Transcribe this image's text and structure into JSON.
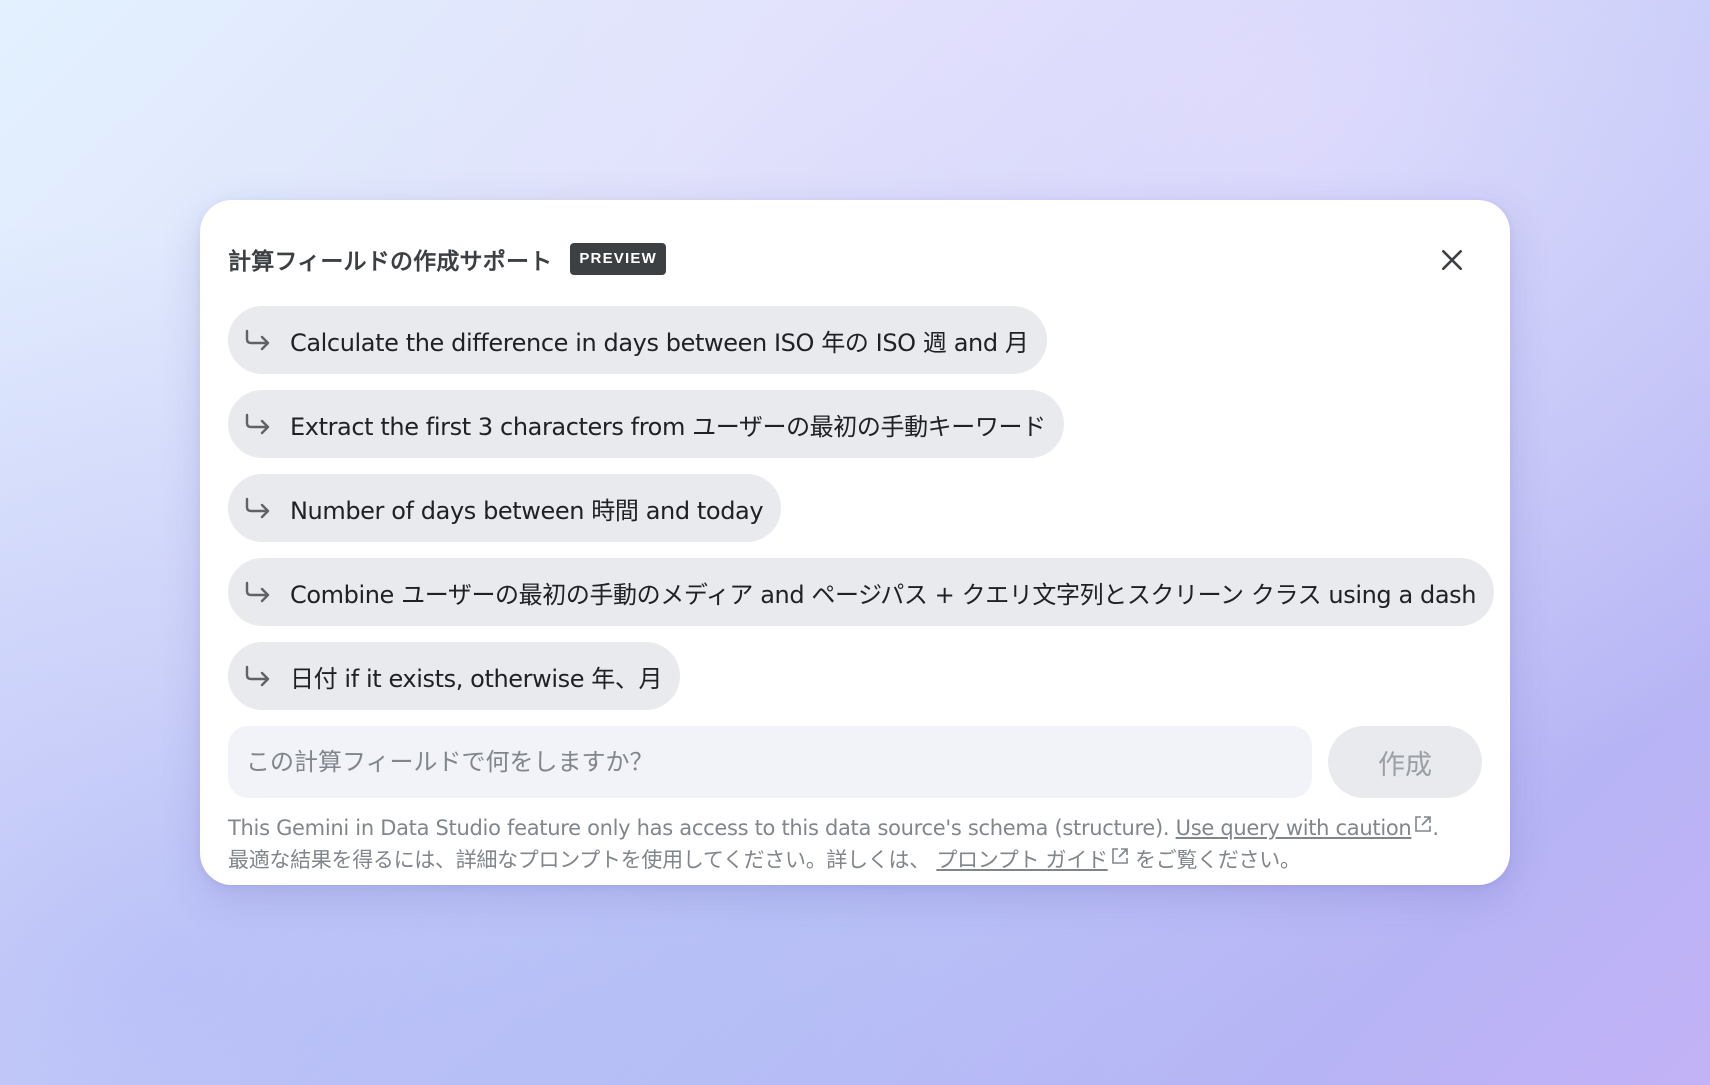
{
  "dialog": {
    "title": "計算フィールドの作成サポート",
    "badge": "PREVIEW",
    "close_icon": "close-icon"
  },
  "suggestions": [
    {
      "icon": "reply-arrow-icon",
      "label": "Calculate the difference in days between ISO 年の ISO 週 and 月"
    },
    {
      "icon": "reply-arrow-icon",
      "label": "Extract the first 3 characters from ユーザーの最初の手動キーワード"
    },
    {
      "icon": "reply-arrow-icon",
      "label": "Number of days between 時間 and today"
    },
    {
      "icon": "reply-arrow-icon",
      "label": "Combine ユーザーの最初の手動のメディア and ページパス + クエリ文字列とスクリーン クラス using a dash"
    },
    {
      "icon": "reply-arrow-icon",
      "label": "日付 if it exists, otherwise 年、月"
    }
  ],
  "input": {
    "value": "",
    "placeholder": "この計算フィールドで何をしますか？"
  },
  "create_button": {
    "label": "作成"
  },
  "footer": {
    "line1_text": "This Gemini in Data Studio feature only has access to this data source's schema (structure). ",
    "line1_link": "Use query with caution",
    "line1_end": ".",
    "line2_text": "最適な結果を得るには、詳細なプロンプトを使用してください。詳しくは、",
    "line2_link": "プロンプト ガイド",
    "line2_end": "をご覧ください。"
  },
  "colors": {
    "chip_bg": "#e8eaed",
    "input_bg": "#f1f3f8",
    "badge_bg": "#3c4043",
    "muted_text": "#80868b"
  }
}
